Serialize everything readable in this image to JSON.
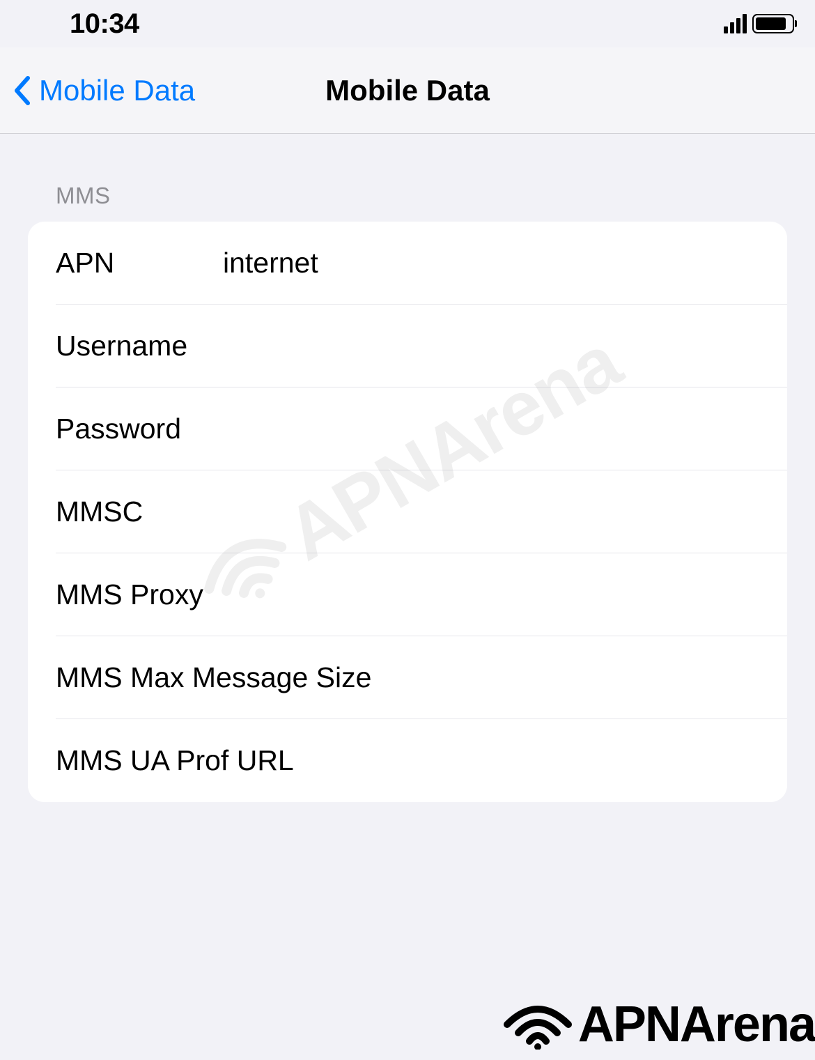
{
  "status": {
    "time": "10:34"
  },
  "nav": {
    "back_label": "Mobile Data",
    "title": "Mobile Data"
  },
  "section": {
    "header": "MMS",
    "rows": [
      {
        "label": "APN",
        "value": "internet",
        "narrow": true
      },
      {
        "label": "Username",
        "value": "",
        "narrow": true
      },
      {
        "label": "Password",
        "value": "",
        "narrow": true
      },
      {
        "label": "MMSC",
        "value": "",
        "narrow": true
      },
      {
        "label": "MMS Proxy",
        "value": "",
        "narrow": true
      },
      {
        "label": "MMS Max Message Size",
        "value": "",
        "narrow": false
      },
      {
        "label": "MMS UA Prof URL",
        "value": "",
        "narrow": false
      }
    ]
  },
  "brand": {
    "name": "APNArena"
  }
}
